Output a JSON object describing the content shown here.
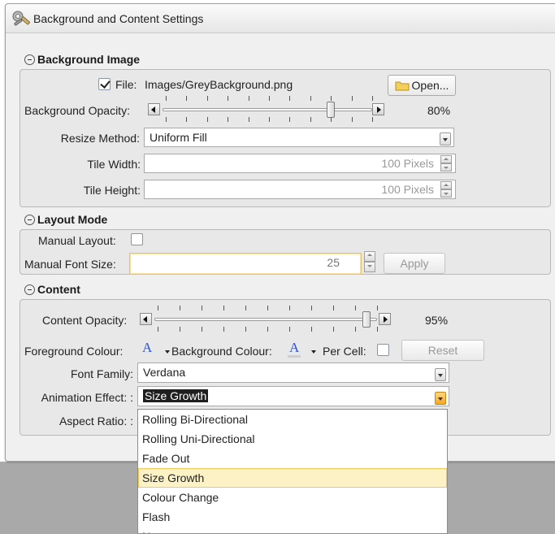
{
  "window": {
    "title": "Background and Content Settings",
    "close": "x"
  },
  "background_image": {
    "header": "Background Image",
    "file_checked": true,
    "file_label": "File:",
    "file_value": "Images/GreyBackground.png",
    "open_button": "Open...",
    "opacity_label": "Background Opacity:",
    "opacity_value": "80%",
    "opacity_fraction": 0.8,
    "resize_label": "Resize Method:",
    "resize_value": "Uniform Fill",
    "tile_width_label": "Tile Width:",
    "tile_width_value": "100 Pixels",
    "tile_height_label": "Tile Height:",
    "tile_height_value": "100 Pixels"
  },
  "layout_mode": {
    "header": "Layout Mode",
    "manual_layout_label": "Manual Layout:",
    "manual_layout_checked": false,
    "font_size_label": "Manual Font Size:",
    "font_size_value": "25",
    "apply_button": "Apply"
  },
  "content": {
    "header": "Content",
    "opacity_label": "Content Opacity:",
    "opacity_value": "95%",
    "opacity_fraction": 0.95,
    "fg_colour_label": "Foreground Colour:",
    "bg_colour_label": "Background Colour:",
    "colour_glyph": "A",
    "per_cell_label": "Per Cell:",
    "per_cell_checked": false,
    "reset_button": "Reset",
    "font_family_label": "Font Family:",
    "font_family_value": "Verdana",
    "animation_label": "Animation Effect: :",
    "animation_value": "Size Growth",
    "aspect_label": "Aspect Ratio: :"
  },
  "animation_options": [
    "Rolling Bi-Directional",
    "Rolling Uni-Directional",
    "Fade Out",
    "Size Growth",
    "Colour Change",
    "Flash",
    "None"
  ],
  "animation_selected_index": 3,
  "colors": {
    "accent_orange": "#f5a623",
    "selection_bg": "#fdf1c6",
    "group_bg": "#e8e8e8"
  }
}
